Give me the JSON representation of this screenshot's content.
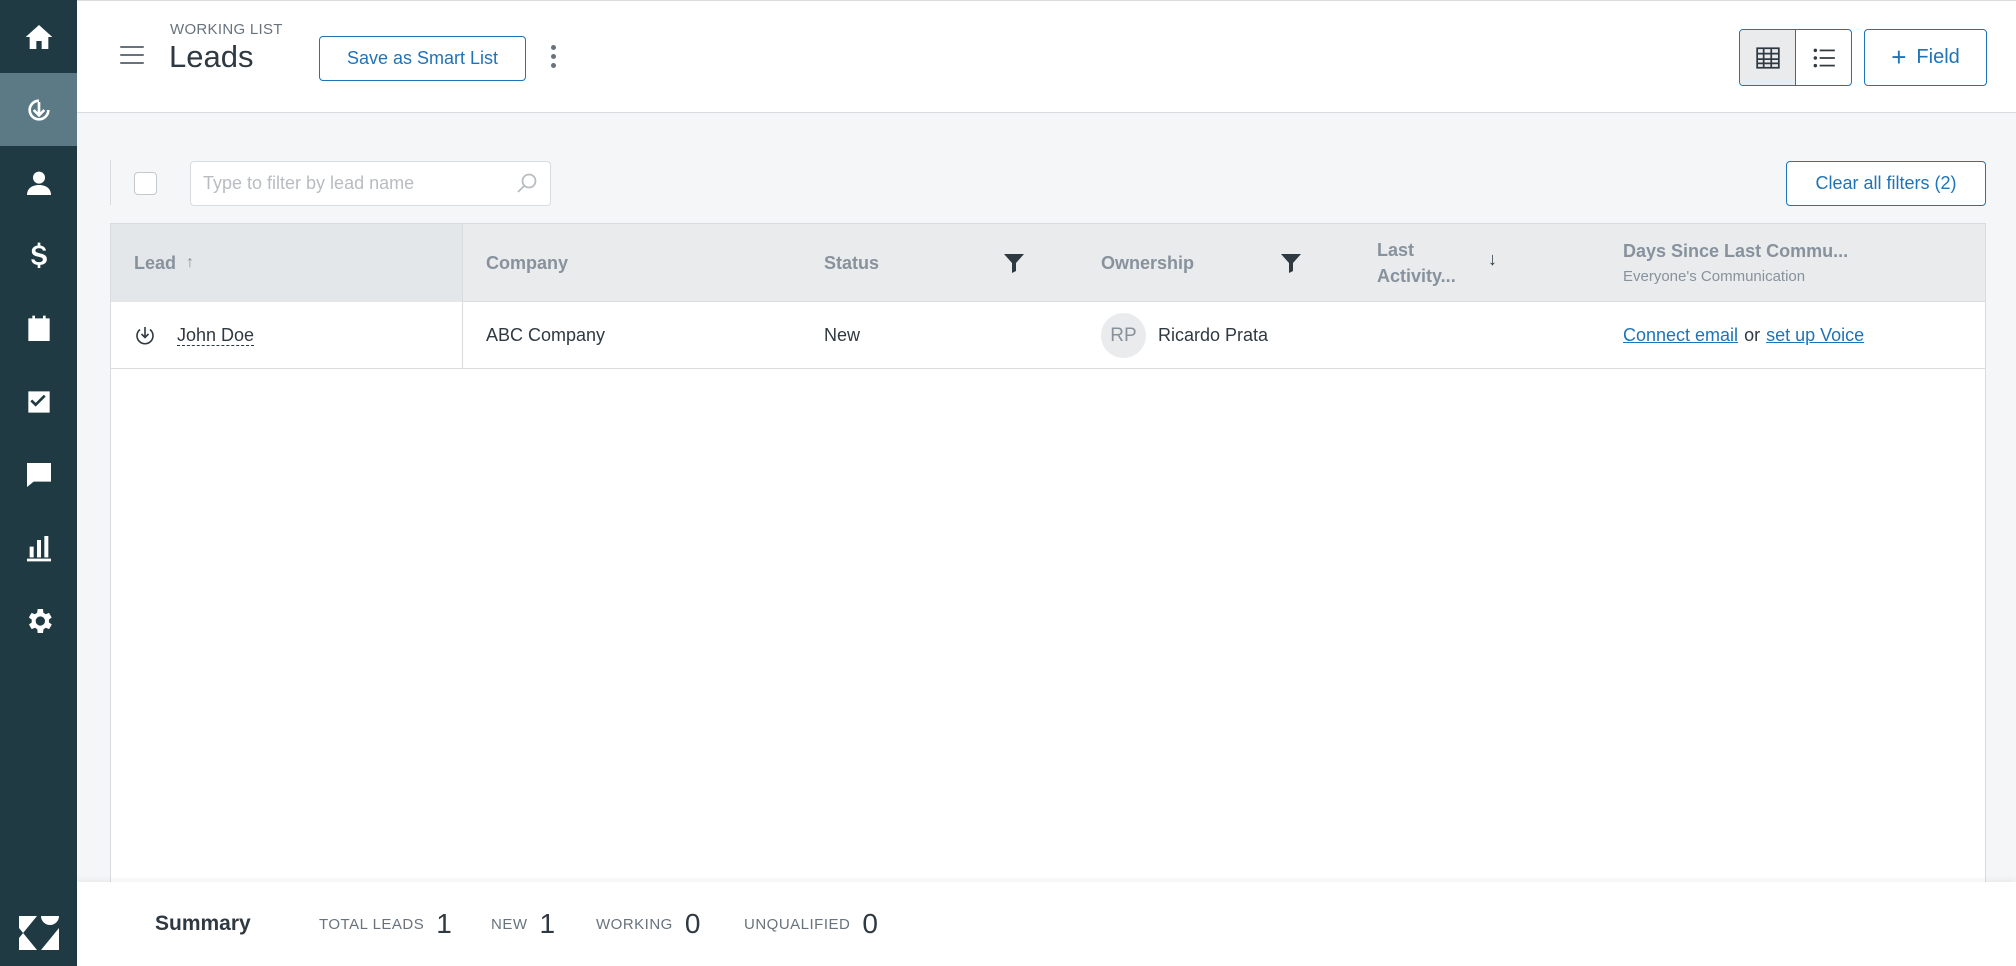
{
  "sidebar": {
    "items": [
      {
        "icon": "home-icon",
        "active": false
      },
      {
        "icon": "leads-icon",
        "active": true
      },
      {
        "icon": "contact-icon",
        "active": false
      },
      {
        "icon": "dollar-icon",
        "active": false
      },
      {
        "icon": "calendar-icon",
        "active": false
      },
      {
        "icon": "task-icon",
        "active": false
      },
      {
        "icon": "chat-icon",
        "active": false
      },
      {
        "icon": "reports-icon",
        "active": false
      },
      {
        "icon": "settings-icon",
        "active": false
      }
    ],
    "logo": "zendesk-logo"
  },
  "header": {
    "subtitle": "WORKING LIST",
    "title": "Leads",
    "save_smart_list_label": "Save as Smart List",
    "add_field_label": "Field"
  },
  "filter": {
    "search_placeholder": "Type to filter by lead name",
    "search_value": "",
    "clear_filters_label": "Clear all filters (2)"
  },
  "table": {
    "columns": {
      "lead": "Lead",
      "company": "Company",
      "status": "Status",
      "ownership": "Ownership",
      "last_activity_line1": "Last",
      "last_activity_line2": "Activity...",
      "days_since": "Days Since Last Commu...",
      "days_since_sub": "Everyone's Communication"
    },
    "rows": [
      {
        "lead": "John Doe",
        "company": "ABC Company",
        "status": "New",
        "owner_initials": "RP",
        "owner_name": "Ricardo Prata",
        "connect_email": "Connect email",
        "or_text": "or",
        "setup_voice": "set up Voice"
      }
    ]
  },
  "summary": {
    "title": "Summary",
    "total_leads_label": "TOTAL LEADS",
    "total_leads": "1",
    "new_label": "NEW",
    "new_count": "1",
    "working_label": "WORKING",
    "working_count": "0",
    "unqualified_label": "UNQUALIFIED",
    "unqualified_count": "0"
  },
  "colors": {
    "sidebar_bg": "#1f3a43",
    "sidebar_active": "#5b7a86",
    "accent": "#1f73b7"
  }
}
